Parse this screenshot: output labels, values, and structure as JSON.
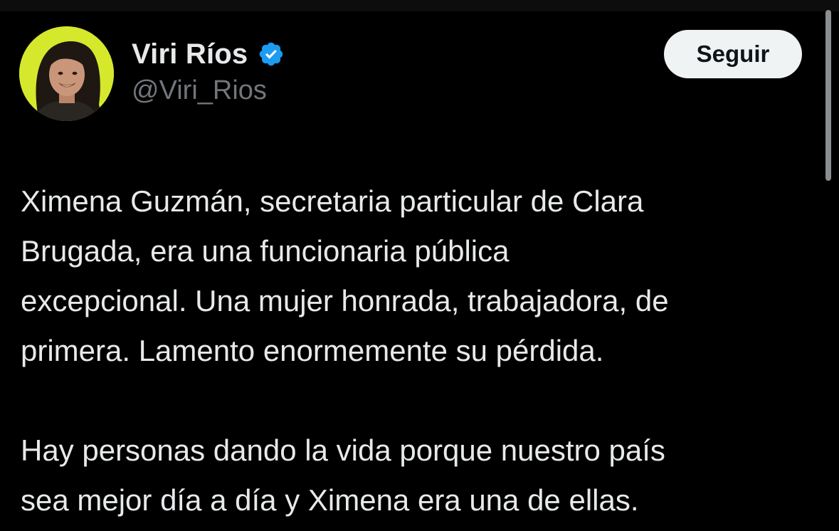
{
  "colors": {
    "background": "#000000",
    "text_primary": "#e7e9ea",
    "text_secondary": "#71767b",
    "verified_blue": "#1d9bf0",
    "avatar_bg": "#d6e82c",
    "button_bg": "#eff3f4"
  },
  "author": {
    "display_name": "Viri Ríos",
    "handle": "@Viri_Rios",
    "verified_icon": "verified-badge-icon",
    "avatar_icon": "avatar-photo"
  },
  "actions": {
    "follow_label": "Seguir"
  },
  "tweet": {
    "paragraph1": [
      "Ximena Guzmán, secretaria particular de Clara",
      "Brugada, era una funcionaria pública",
      "excepcional. Una mujer honrada, trabajadora, de",
      "primera. Lamento enormemente su pérdida."
    ],
    "paragraph2": [
      "Hay personas dando la vida porque nuestro país",
      "sea mejor día a día y Ximena era una de ellas."
    ]
  }
}
